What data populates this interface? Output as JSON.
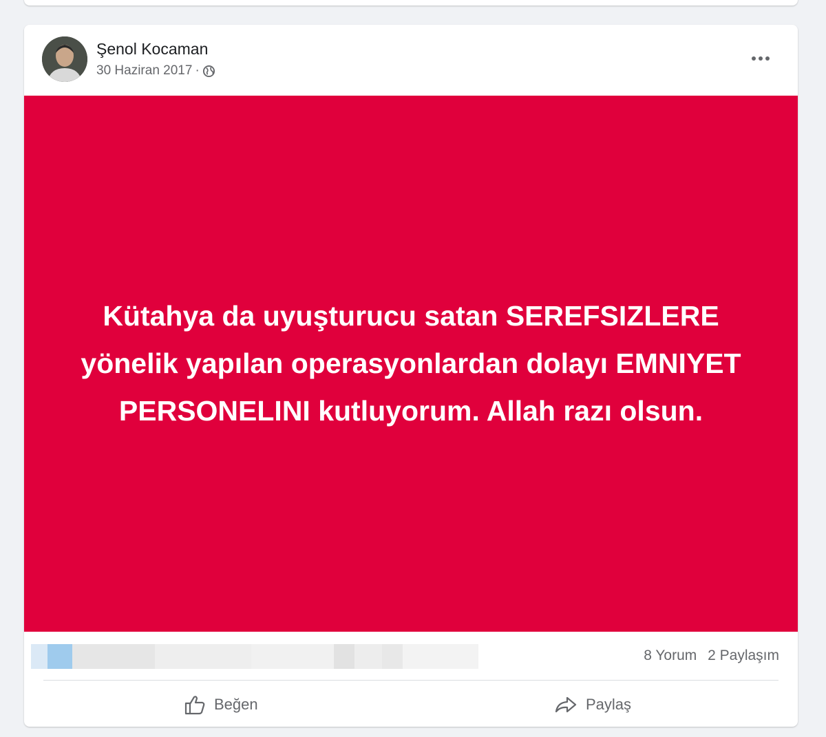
{
  "post": {
    "author_name": "Şenol Kocaman",
    "date": "30 Haziran 2017",
    "separator": "·",
    "visibility_icon": "globe-icon",
    "more_icon": "more-options-icon",
    "image_background": "#e0003c",
    "image_text": "Kütahya da uyuşturucu satan SEREFSIZLERE yönelik yapılan operasyonlardan dolayı EMNIYET PERSONELINI kutluyorum. Allah razı olsun."
  },
  "stats": {
    "comments": "8 Yorum",
    "shares": "2 Paylaşım"
  },
  "actions": {
    "like_label": "Beğen",
    "like_icon": "thumbs-up-icon",
    "share_label": "Paylaş",
    "share_icon": "share-arrow-icon"
  },
  "colors": {
    "card_bg": "#ffffff",
    "page_bg": "#f0f2f5",
    "secondary_text": "#65676b"
  }
}
